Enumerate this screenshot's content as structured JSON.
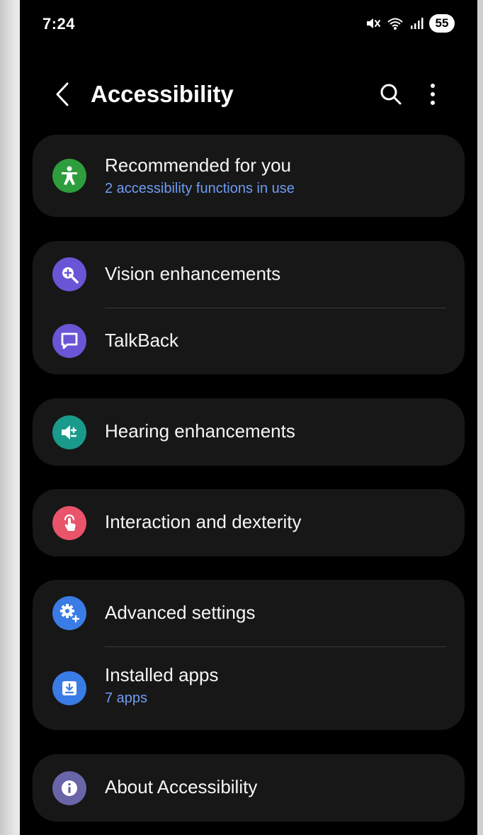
{
  "status_bar": {
    "time": "7:24",
    "battery": "55",
    "icons": [
      "mute-icon",
      "wifi-icon",
      "signal-icon",
      "battery-icon"
    ]
  },
  "header": {
    "title": "Accessibility",
    "back_icon": "chevron-left-icon",
    "search_icon": "search-icon",
    "more_icon": "more-vertical-icon"
  },
  "cards": {
    "recommended": {
      "title": "Recommended for you",
      "subtitle": "2 accessibility functions in use",
      "icon": "accessibility-person-icon",
      "color": "#2e9d3d"
    },
    "vision": {
      "title": "Vision enhancements",
      "icon": "magnifier-plus-icon",
      "color": "#6a55d6"
    },
    "talkback": {
      "title": "TalkBack",
      "icon": "chat-bubble-icon",
      "color": "#6a55d6"
    },
    "hearing": {
      "title": "Hearing enhancements",
      "icon": "speaker-icon",
      "color": "#1a9a8a"
    },
    "interaction": {
      "title": "Interaction and dexterity",
      "icon": "touch-hand-icon",
      "color": "#e9546b"
    },
    "advanced": {
      "title": "Advanced settings",
      "icon": "gear-plus-icon",
      "color": "#3a7ce6"
    },
    "installed": {
      "title": "Installed apps",
      "subtitle": "7 apps",
      "icon": "download-icon",
      "color": "#3a7ce6"
    },
    "about": {
      "title": "About Accessibility",
      "icon": "info-icon",
      "color": "#6a65a8"
    }
  },
  "colors": {
    "background": "#000000",
    "card": "#171717",
    "link_blue": "#6f9cf2"
  }
}
